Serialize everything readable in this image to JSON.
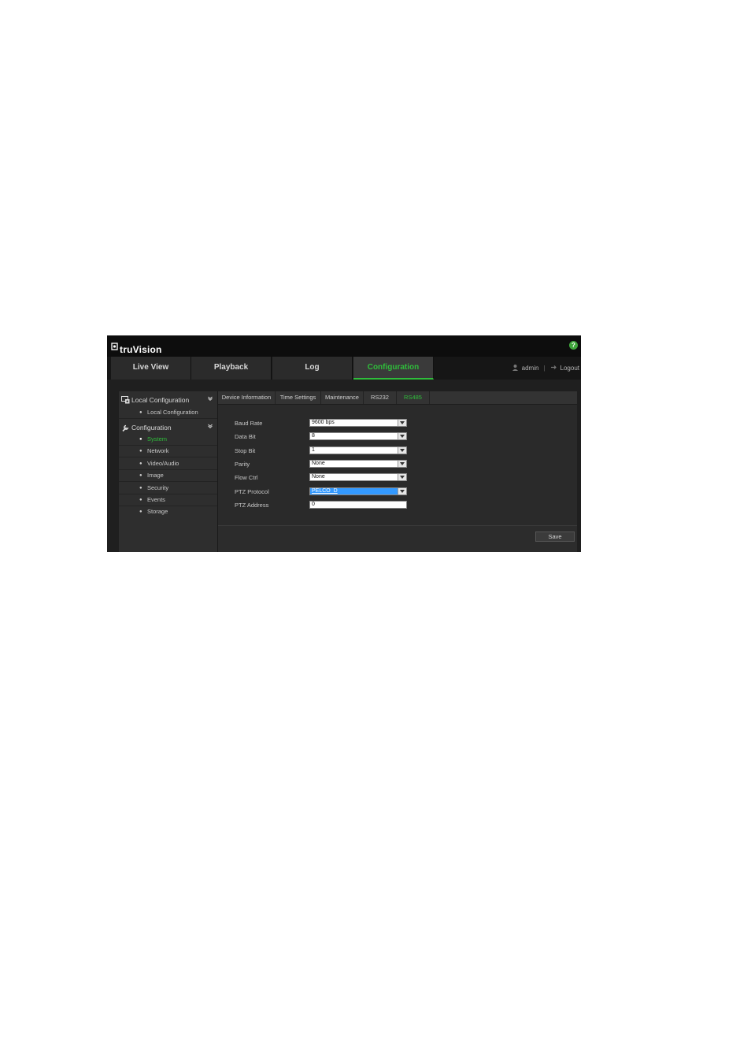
{
  "app": {
    "brand": "truVision",
    "help_label": "?"
  },
  "nav": {
    "tabs": [
      {
        "label": "Live View"
      },
      {
        "label": "Playback"
      },
      {
        "label": "Log"
      },
      {
        "label": "Configuration",
        "active": true
      }
    ],
    "user": "admin",
    "logout": "Logout"
  },
  "sidebar": {
    "groups": [
      {
        "label": "Local Configuration",
        "items": [
          "Local Configuration"
        ]
      },
      {
        "label": "Configuration",
        "items": [
          "System",
          "Network",
          "Video/Audio",
          "Image",
          "Security",
          "Events",
          "Storage"
        ],
        "active_item": "System"
      }
    ]
  },
  "subtabs": [
    "Device Information",
    "Time Settings",
    "Maintenance",
    "RS232",
    "RS485"
  ],
  "active_subtab": "RS485",
  "form": {
    "fields": [
      {
        "label": "Baud Rate",
        "value": "9600 bps",
        "type": "select"
      },
      {
        "label": "Data Bit",
        "value": "8",
        "type": "select"
      },
      {
        "label": "Stop Bit",
        "value": "1",
        "type": "select"
      },
      {
        "label": "Parity",
        "value": "None",
        "type": "select"
      },
      {
        "label": "Flow Ctrl",
        "value": "None",
        "type": "select"
      },
      {
        "label": "PTZ Protocol",
        "value": "PELCO_D",
        "type": "select",
        "highlighted": true
      },
      {
        "label": "PTZ Address",
        "value": "0",
        "type": "text"
      }
    ],
    "save_label": "Save"
  },
  "colors": {
    "accent": "#2fbd3b",
    "background": "#1d1d1d",
    "selection": "#3399ff"
  }
}
